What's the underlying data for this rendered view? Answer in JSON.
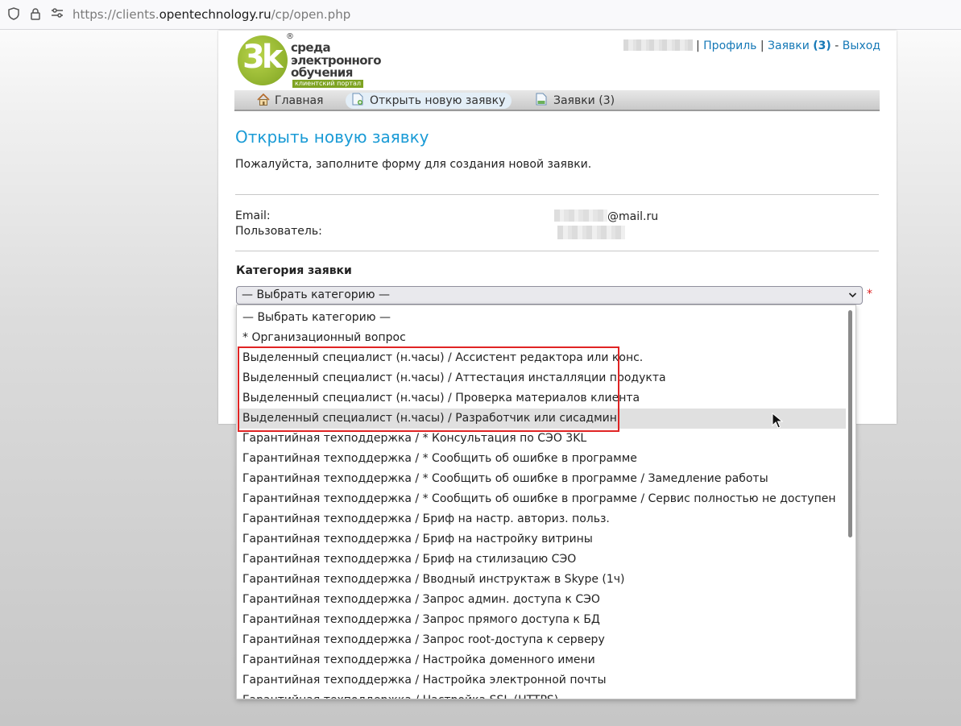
{
  "browser": {
    "url_prefix": "https://clients.",
    "url_domain": "opentechnology.ru",
    "url_path": "/cp/open.php"
  },
  "logo": {
    "mark": "3k",
    "reg": "®",
    "line1": "среда",
    "line2": "электронного",
    "line3": "обучения",
    "tagline": "клиентский портал"
  },
  "topnav": {
    "separator": "|",
    "profile": "Профиль",
    "tickets": "Заявки",
    "tickets_count": "(3)",
    "dash": "-",
    "logout": "Выход"
  },
  "menu": {
    "home": "Главная",
    "new_ticket": "Открыть новую заявку",
    "tickets": "Заявки (3)"
  },
  "page": {
    "title": "Открыть новую заявку",
    "intro": "Пожалуйста, заполните форму для создания новой заявки.",
    "email_label": "Email:",
    "email_value_suffix": "@mail.ru",
    "user_label": "Пользователь:",
    "category_label": "Категория заявки",
    "category_selected": "— Выбрать категорию —",
    "required_mark": "*"
  },
  "dropdown": {
    "options": [
      "— Выбрать категорию —",
      "* Организационный вопрос",
      "Выделенный специалист (н.часы) / Ассистент редактора или конс.",
      "Выделенный специалист (н.часы) / Аттестация инсталляции продукта",
      "Выделенный специалист (н.часы) / Проверка материалов клиента",
      "Выделенный специалист (н.часы) / Разработчик или сисадмин",
      "Гарантийная техподдержка / * Консультация по СЭО 3KL",
      "Гарантийная техподдержка / * Сообщить об ошибке в программе",
      "Гарантийная техподдержка / * Сообщить об ошибке в программе / Замедление работы",
      "Гарантийная техподдержка / * Сообщить об ошибке в программе / Сервис полностью не доступен",
      "Гарантийная техподдержка / Бриф на настр. авториз. польз.",
      "Гарантийная техподдержка / Бриф на настройку витрины",
      "Гарантийная техподдержка / Бриф на стилизацию СЭО",
      "Гарантийная техподдержка / Вводный инструктаж в Skype (1ч)",
      "Гарантийная техподдержка / Запрос админ. доступа к СЭО",
      "Гарантийная техподдержка / Запрос прямого доступа к БД",
      "Гарантийная техподдержка / Запрос root-доступа к серверу",
      "Гарантийная техподдержка / Настройка доменного имени",
      "Гарантийная техподдержка / Настройка электронной почты",
      "Гарантийная техподдержка / Настройка SSL (HTTPS)"
    ],
    "hovered_index": 5
  }
}
